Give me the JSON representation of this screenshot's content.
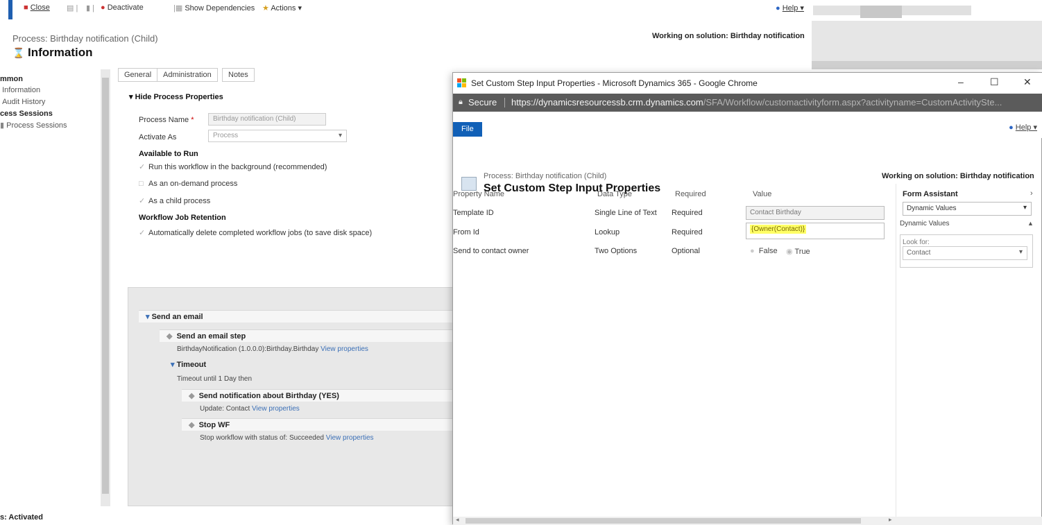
{
  "toolbar": {
    "close": "Close",
    "deactivate": "Deactivate",
    "show_dependencies": "Show Dependencies",
    "actions": "Actions ▾",
    "help": "Help ▾"
  },
  "header": {
    "subtitle": "Process: Birthday notification (Child)",
    "title": "Information",
    "solution": "Working on solution: Birthday notification"
  },
  "sidebar": {
    "heading1": "mmon",
    "items1": [
      "Information",
      "Audit History"
    ],
    "heading2": "cess Sessions",
    "items2": [
      "Process Sessions"
    ]
  },
  "tabs": [
    "General",
    "Administration",
    "Notes"
  ],
  "general": {
    "section": "Hide Process Properties",
    "process_name_label": "Process Name",
    "process_name_value": "Birthday notification (Child)",
    "activate_as_label": "Activate As",
    "activate_as_value": "Process",
    "available_heading": "Available to Run",
    "run_bg": "Run this workflow in the background (recommended)",
    "on_demand": "As an on-demand process",
    "child_process": "As a child process",
    "retention_heading": "Workflow Job Retention",
    "auto_delete": "Automatically delete completed workflow jobs (to save disk space)"
  },
  "steps": {
    "send_email": "Send an email",
    "send_email_step": "Send an email step",
    "bday_line": "BirthdayNotification (1.0.0.0):Birthday.Birthday",
    "view_properties": "View properties",
    "timeout": "Timeout",
    "timeout_line": "Timeout until 1 Day then",
    "send_notification": "Send notification about Birthday (YES)",
    "update_line": "Update:  Contact",
    "stop_wf": "Stop WF",
    "stop_line": "Stop workflow with status of:  Succeeded"
  },
  "status": "s: Activated",
  "popup": {
    "title": "Set Custom Step Input Properties - Microsoft Dynamics 365 - Google Chrome",
    "secure": "Secure",
    "url_main": "https://dynamicsresourcessb.crm.dynamics.com",
    "url_rest": "/SFA/Workflow/customactivityform.aspx?activityname=CustomActivitySte...",
    "file": "File",
    "help": "Help ▾",
    "subtitle": "Process: Birthday notification (Child)",
    "title_main": "Set Custom Step Input Properties",
    "solution": "Working on solution: Birthday notification",
    "columns": [
      "Property Name",
      "Data Type",
      "Required",
      "Value"
    ],
    "rows": [
      {
        "name": "Template ID",
        "type": "Single Line of Text",
        "required": "Required",
        "value": "Contact Birthday"
      },
      {
        "name": "From Id",
        "type": "Lookup",
        "required": "Required",
        "value": "{Owner(Contact)}"
      },
      {
        "name": "Send to contact owner",
        "type": "Two Options",
        "required": "Optional",
        "false": "False",
        "true": "True"
      }
    ],
    "assistant": {
      "heading": "Form Assistant",
      "select": "Dynamic Values",
      "sub": "Dynamic Values",
      "look_for": "Look for:",
      "entity": "Contact"
    }
  },
  "colors": {
    "accent": "#1160b7",
    "highlight": "#ffff66",
    "urlbar": "#5b5b5b"
  }
}
